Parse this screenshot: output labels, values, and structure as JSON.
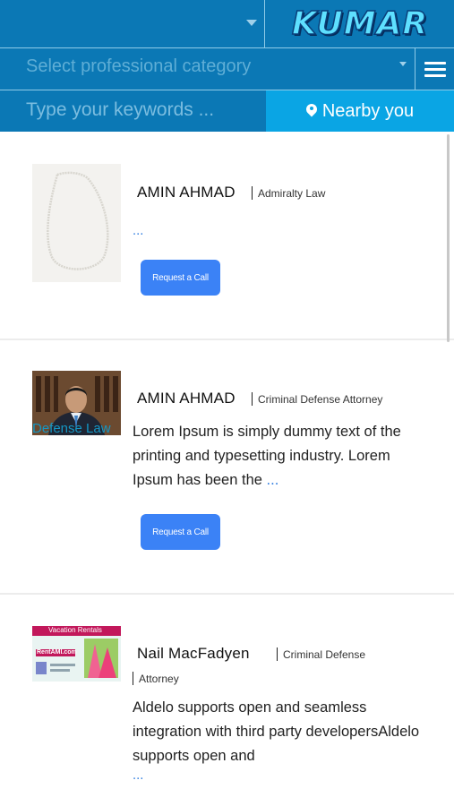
{
  "header": {
    "logo_text": "KUMAR",
    "category_placeholder": "Select professional category",
    "keywords_placeholder": "Type your keywords ...",
    "nearby_label": "Nearby you"
  },
  "listings": [
    {
      "name": "AMIN AHMAD",
      "category": "Admiralty Law",
      "description": "",
      "more": "...",
      "button": "Request a Call",
      "image": "necklace-photo"
    },
    {
      "name": "AMIN AHMAD",
      "category": "Criminal Defense Attorney",
      "tag": "Defense Law",
      "description": "Lorem Ipsum is simply dummy text of the printing and typesetting industry. Lorem Ipsum has been the",
      "more": "...",
      "button": "Request a Call",
      "image": "lawyer-portrait-photo"
    },
    {
      "name": "Nail MacFadyen",
      "category": "Criminal Defense",
      "category_cont": "Attorney",
      "description": "Aldelo supports open and seamless integration with third party developersAldelo supports open and",
      "more": "...",
      "image": "vacation-rentals-banner"
    }
  ],
  "banner": {
    "title": "Vacation Rentals",
    "site": "RentAMI.com"
  },
  "colors": {
    "header_bg": "#0b78b5",
    "nearby_bg": "#0aa5e4",
    "button_bg": "#3b82f6",
    "link": "#2f7de0"
  }
}
